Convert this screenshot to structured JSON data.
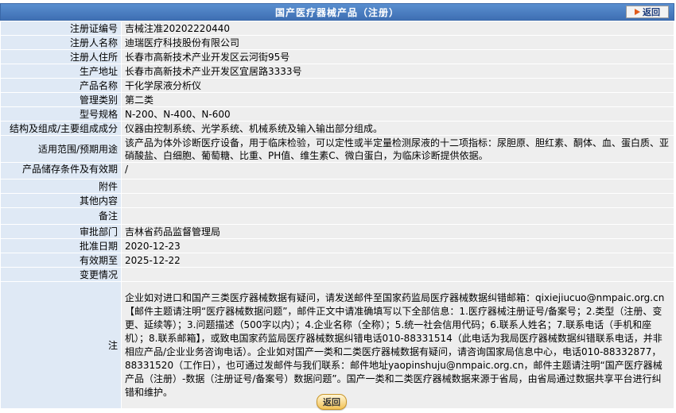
{
  "header": {
    "title": "国产医疗器械产品（注册）",
    "back_label": "返回"
  },
  "rows": {
    "reg_no": {
      "label": "注册证编号",
      "value": "吉械注准20202220440"
    },
    "registrant": {
      "label": "注册人名称",
      "value": "迪瑞医疗科技股份有限公司"
    },
    "reg_address": {
      "label": "注册人住所",
      "value": "长春市高新技术产业开发区云河街95号"
    },
    "prod_address": {
      "label": "生产地址",
      "value": "长春市高新技术产业开发区宜居路3333号"
    },
    "product_name": {
      "label": "产品名称",
      "value": "干化学尿液分析仪"
    },
    "mgmt_class": {
      "label": "管理类别",
      "value": "第二类"
    },
    "model": {
      "label": "型号规格",
      "value": "N-200、N-400、N-600"
    },
    "structure": {
      "label": "结构及组成/主要组成成分",
      "value": "仪器由控制系统、光学系统、机械系统及输入输出部分组成。"
    },
    "scope": {
      "label": "适用范围/预期用途",
      "value": "该产品为体外诊断医疗设备，用于临床检验，可以定性或半定量检测尿液的十二项指标：尿胆原、胆红素、酮体、血、蛋白质、亚硝酸盐、白细胞、葡萄糖、比重、PH值、维生素C、微白蛋白，为临床诊断提供依据。"
    },
    "storage": {
      "label": "产品储存条件及有效期",
      "value": "/"
    },
    "attachment": {
      "label": "附件",
      "value": ""
    },
    "other": {
      "label": "其他内容",
      "value": ""
    },
    "remark": {
      "label": "备注",
      "value": ""
    },
    "approver": {
      "label": "审批部门",
      "value": "吉林省药品监督管理局"
    },
    "approval_date": {
      "label": "批准日期",
      "value": "2020-12-23"
    },
    "valid_until": {
      "label": "有效期至",
      "value": "2025-12-22"
    },
    "changes": {
      "label": "变更情况",
      "value": ""
    },
    "note": {
      "label": "注",
      "value": "企业如对进口和国产三类医疗器械数据有疑问，请发送邮件至国家药监局医疗器械数据纠错邮箱：qixiejiucuo@nmpaic.org.cn【邮件主题请注明“医疗器械数据问题”，邮件正文中请准确填写以下全部信息：1.医疗器械注册证号/备案号；2.类型（注册、变更、延续等）；3.问题描述（500字以内）；4.企业名称（全称）；5.统一社会信用代码；6.联系人姓名；7.联系电话（手机和座机）；8.联系邮箱】，或致电国家药监局医疗器械数据纠错电话010-88331514（此电话为我局医疗器械数据纠错联系电话，并非相应产品/企业业务咨询电话）。企业如对国产一类和二类医疗器械数据有疑问，请咨询国家局信息中心，电话010-88332877，88331520（工作日），也可通过发邮件与我们联系：邮件地址yaopinshuju@nmpaic.org.cn，邮件主题请注明“国产医疗器械产品（注册）-数据（注册证号/备案号）数据问题”。国产一类和二类医疗器械数据来源于省局，由省局通过数据共享平台进行纠错和维护。"
    }
  },
  "footer": {
    "back_label": "返回"
  },
  "colors": {
    "title_bg": "#4a7fc1",
    "label_bg": "#dfe9f5",
    "value_bg": "#eeeeee"
  }
}
